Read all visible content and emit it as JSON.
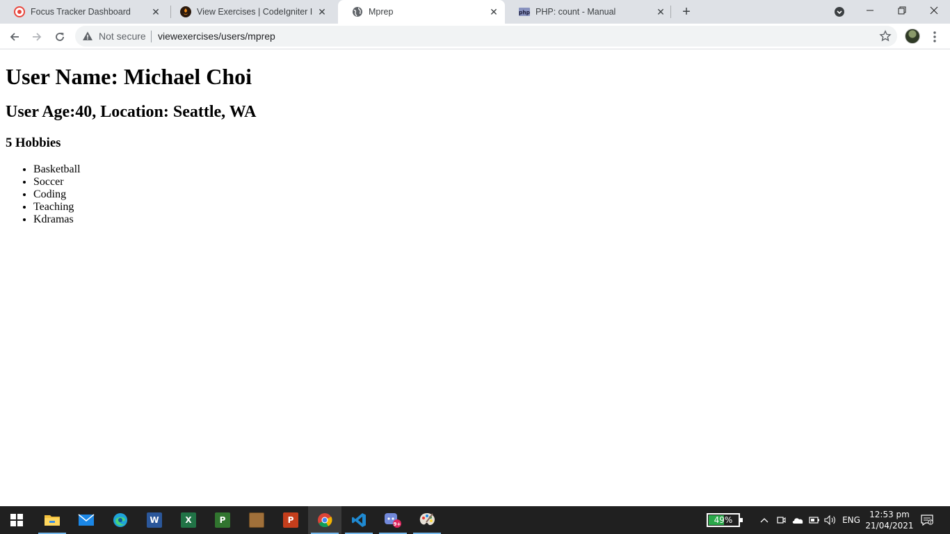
{
  "browser": {
    "tabs": [
      {
        "title": "Focus Tracker Dashboard",
        "favicon": "focus-tracker-icon",
        "active": false
      },
      {
        "title": "View Exercises | CodeIgniter I",
        "favicon": "codeigniter-icon",
        "active": false
      },
      {
        "title": "Mprep",
        "favicon": "globe-icon",
        "active": true
      },
      {
        "title": "PHP: count - Manual",
        "favicon": "php-icon",
        "active": false
      }
    ],
    "address": {
      "security_label": "Not secure",
      "url": "viewexercises/users/mprep"
    }
  },
  "page": {
    "heading": "User Name: Michael Choi",
    "subheading": "User Age:40, Location: Seattle, WA",
    "hobbies_title": "5 Hobbies",
    "hobbies": [
      "Basketball",
      "Soccer",
      "Coding",
      "Teaching",
      "Kdramas"
    ]
  },
  "taskbar": {
    "apps": [
      {
        "name": "file-explorer",
        "icon": "folder-icon",
        "running": true
      },
      {
        "name": "mail",
        "icon": "mail-icon",
        "running": false
      },
      {
        "name": "edge",
        "icon": "edge-icon",
        "running": false
      },
      {
        "name": "word",
        "icon": "word-icon",
        "running": false
      },
      {
        "name": "excel",
        "icon": "excel-icon",
        "running": false
      },
      {
        "name": "project",
        "icon": "project-icon",
        "running": false
      },
      {
        "name": "bible",
        "icon": "book-icon",
        "running": false
      },
      {
        "name": "powerpoint",
        "icon": "powerpoint-icon",
        "running": false
      },
      {
        "name": "chrome",
        "icon": "chrome-icon",
        "running": true
      },
      {
        "name": "vscode",
        "icon": "vscode-icon",
        "running": true
      },
      {
        "name": "discord",
        "icon": "discord-icon",
        "running": true
      },
      {
        "name": "paint",
        "icon": "palette-icon",
        "running": true
      }
    ],
    "discord_badge": "9+",
    "battery_percent": "49%",
    "battery_level": 0.49,
    "language": "ENG",
    "time": "12:53 pm",
    "date": "21/04/2021"
  },
  "colors": {
    "tabstrip_bg": "#dee1e6",
    "omnibox_bg": "#f1f3f4",
    "taskbar_bg": "#202020",
    "running_indicator": "#76b9ed"
  }
}
